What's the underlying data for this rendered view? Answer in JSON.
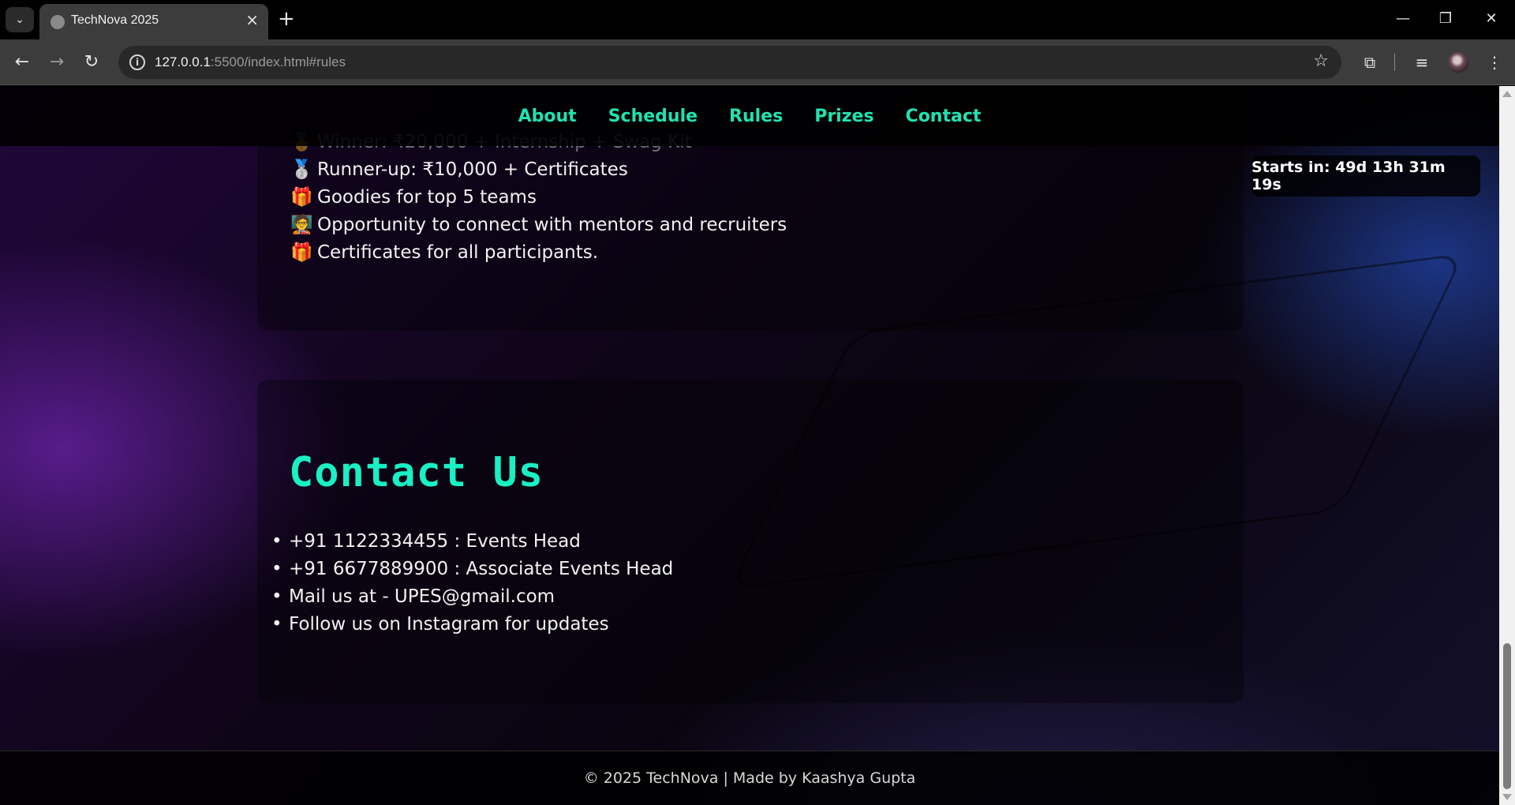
{
  "browser": {
    "tab_title": "TechNova 2025",
    "url_host": "127.0.0.1",
    "url_rest": ":5500/index.html#rules",
    "icons": [
      "tab-search-icon",
      "favicon-globe-icon",
      "close-icon",
      "plus-icon",
      "minimize-icon",
      "restore-icon",
      "window-close-icon",
      "back-arrow-icon",
      "forward-arrow-icon",
      "reload-icon",
      "info-icon",
      "star-icon",
      "extensions-icon",
      "media-controls-icon",
      "profile-avatar",
      "more-menu-icon"
    ]
  },
  "nav": {
    "items": [
      "About",
      "Schedule",
      "Rules",
      "Prizes",
      "Contact"
    ]
  },
  "countdown": {
    "text": "Starts in: 49d 13h 31m 19s"
  },
  "prizes": {
    "items": [
      {
        "emoji": "🥇",
        "text": "Winner: ₹20,000 + Internship + Swag Kit"
      },
      {
        "emoji": "🥈",
        "text": "Runner-up: ₹10,000 + Certificates"
      },
      {
        "emoji": "🎁",
        "text": "Goodies for top 5 teams"
      },
      {
        "emoji": "🧑‍🏫",
        "text": "Opportunity to connect with mentors and recruiters"
      },
      {
        "emoji": "🎁",
        "text": "Certificates for all participants."
      }
    ]
  },
  "contact": {
    "title": "Contact Us",
    "items": [
      "+91 1122334455 : Events Head",
      "+91 6677889900 : Associate Events Head",
      "Mail us at - UPES@gmail.com",
      "Follow us on Instagram for updates"
    ]
  },
  "footer": {
    "text": "© 2025 TechNova | Made by Kaashya Gupta"
  },
  "colors": {
    "accent": "#20e3b2",
    "title": "#19f0c4"
  }
}
